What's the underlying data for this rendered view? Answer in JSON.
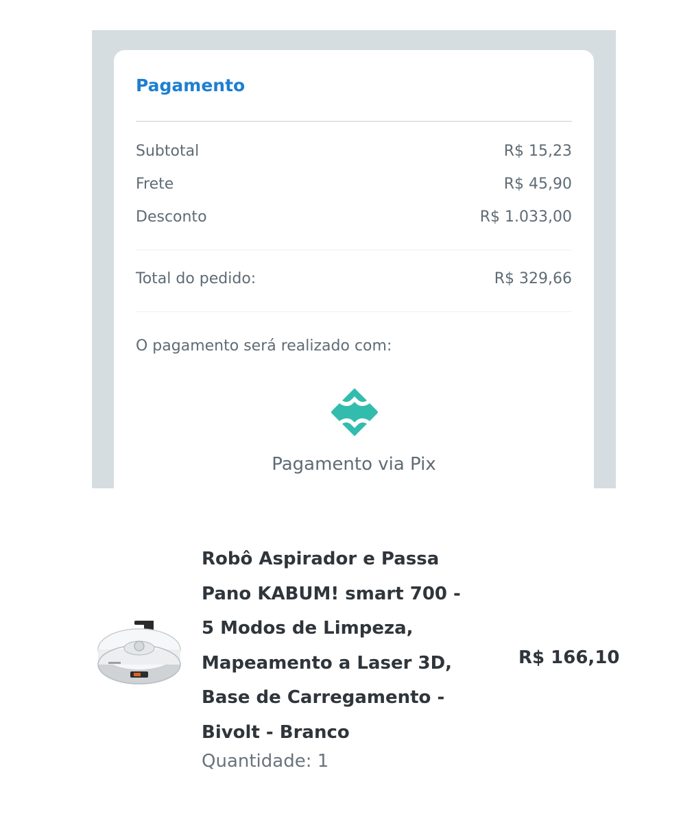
{
  "payment": {
    "title": "Pagamento",
    "rows": [
      {
        "label": "Subtotal",
        "value": "R$ 15,23"
      },
      {
        "label": "Frete",
        "value": "R$ 45,90"
      },
      {
        "label": "Desconto",
        "value": "R$ 1.033,00"
      }
    ],
    "total": {
      "label": "Total do pedido:",
      "value": "R$ 329,66"
    },
    "method_intro": "O pagamento será realizado com:",
    "method_icon": "pix-icon",
    "method_label": "Pagamento via Pix",
    "colors": {
      "accent": "#1d7fd1",
      "pix": "#32bcad",
      "panel_bg": "#d5dde1"
    }
  },
  "product": {
    "title_lines": [
      "Robô Aspirador e Passa",
      "Pano KABUM! smart 700 -",
      "5 Modos de Limpeza,",
      "Mapeamento a Laser 3D,",
      "Base de Carregamento -",
      "Bivolt - Branco"
    ],
    "price": "R$ 166,10",
    "quantity": "Quantidade: 1",
    "image_icon": "robot-vacuum-image"
  }
}
